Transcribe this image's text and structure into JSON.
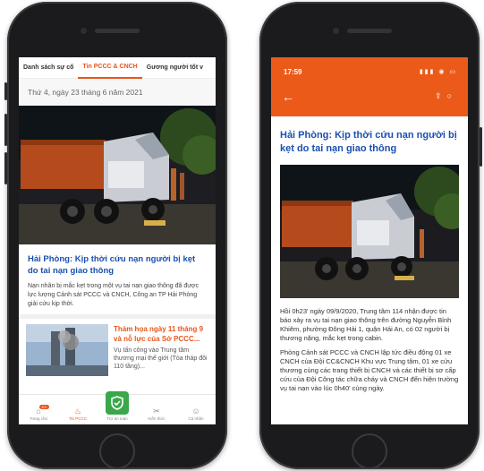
{
  "left": {
    "tabs": [
      "Danh sách sự cố",
      "Tin PCCC & CNCH",
      "Gương người tốt v"
    ],
    "active_tab": 1,
    "date": "Thứ 4, ngày 23 tháng 6 năm 2021",
    "featured": {
      "title": "Hải Phòng: Kịp thời cứu nạn người bị kẹt do tai nạn giao thông",
      "desc": "Nạn nhân bị mắc kẹt trong một vụ tai nạn giao thông đã được lực lượng Cảnh sát PCCC và CNCH, Công an TP Hải Phòng giải cứu kịp thời."
    },
    "second": {
      "title": "Thảm họa ngày 11 tháng 9 và nỗ lực của Sở PCCC...",
      "desc": "Vụ tấn công vào Trung tâm thương mại thế giới (Tòa tháp đôi 110 tầng)..."
    },
    "nav": [
      {
        "label": "Trang chủ",
        "icon": "⌂"
      },
      {
        "label": "Tin PCCC",
        "icon": "♨"
      },
      {
        "label": "Trợ an toàn",
        "icon": "shield"
      },
      {
        "label": "Kiến thức",
        "icon": "✂"
      },
      {
        "label": "Cá nhân",
        "icon": "☺"
      }
    ],
    "badge": "10+"
  },
  "right": {
    "time": "17:59",
    "status_icons": "▮▮▮ ◉ ▭",
    "title": "Hải Phòng: Kịp thời cứu nạn người bị kẹt do tai nạn giao thông",
    "para1": "Hồi 0h23' ngày 09/9/2020, Trung tâm 114 nhận được tin báo xảy ra vụ tai nạn giao thông trên đường Nguyễn Bỉnh Khiêm, phường Đông Hải 1, quận Hải An, có 02 người bị thương nặng, mắc kẹt trong cabin.",
    "para2": "Phòng Cảnh sát PCCC và CNCH lập tức điều động 01 xe CNCH của Đội CC&CNCH Khu vực Trung tâm, 01 xe cứu thương cùng các trang thiết bị CNCH và các thiết bị sơ cấp cứu của Đội Công tác chữa cháy và CNCH đến hiện trường vụ tai nạn vào lúc 0h40' cùng ngày."
  },
  "colors": {
    "accent": "#ec5a1a",
    "title_blue": "#1a4fb0",
    "shield_green": "#3aa84a"
  }
}
